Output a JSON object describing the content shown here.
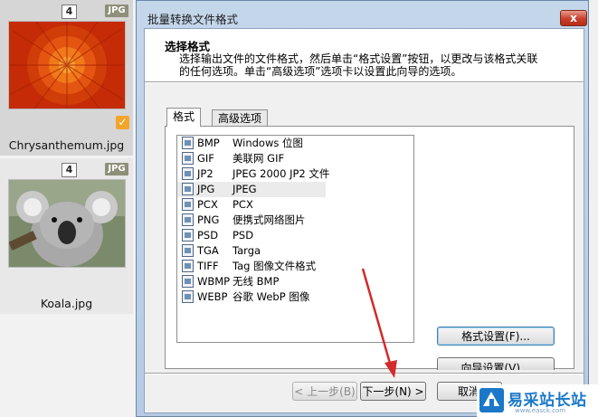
{
  "thumbnails": [
    {
      "count": "4",
      "type": "JPG",
      "caption": "Chrysanthemum.jpg",
      "checked": true
    },
    {
      "count": "4",
      "type": "JPG",
      "caption": "Koala.jpg",
      "checked": false
    }
  ],
  "dialog": {
    "title": "批量转换文件格式",
    "close_label": "x",
    "step_title": "选择格式",
    "step_desc": "选择输出文件的文件格式，然后单击“格式设置”按钮，以更改与该格式关联的任何选项。单击“高级选项”选项卡以设置此向导的选项。",
    "tabs": [
      "格式",
      "高级选项"
    ],
    "formats": [
      {
        "ext": "BMP",
        "desc": "Windows 位图"
      },
      {
        "ext": "GIF",
        "desc": "美联网 GIF"
      },
      {
        "ext": "JP2",
        "desc": "JPEG 2000 JP2 文件"
      },
      {
        "ext": "JPG",
        "desc": "JPEG"
      },
      {
        "ext": "PCX",
        "desc": "PCX"
      },
      {
        "ext": "PNG",
        "desc": "便携式网络图片"
      },
      {
        "ext": "PSD",
        "desc": "PSD"
      },
      {
        "ext": "TGA",
        "desc": "Targa"
      },
      {
        "ext": "TIFF",
        "desc": "Tag 图像文件格式"
      },
      {
        "ext": "WBMP",
        "desc": "无线 BMP"
      },
      {
        "ext": "WEBP",
        "desc": "谷歌 WebP 图像"
      }
    ],
    "selected_format": "JPG",
    "format_settings_label": "格式设置(F)...",
    "wizard_settings_label": "向导设置(V)...",
    "prev_label": "< 上一步(B)",
    "next_label": "下一步(N) >",
    "cancel_label": "取消"
  },
  "watermark": {
    "text": "易采站长站",
    "url": "www.easck.com"
  },
  "colors": {
    "accent_check": "#f3a42c",
    "annotation_arrow": "#d42a2a",
    "watermark": "#1b78c8"
  }
}
